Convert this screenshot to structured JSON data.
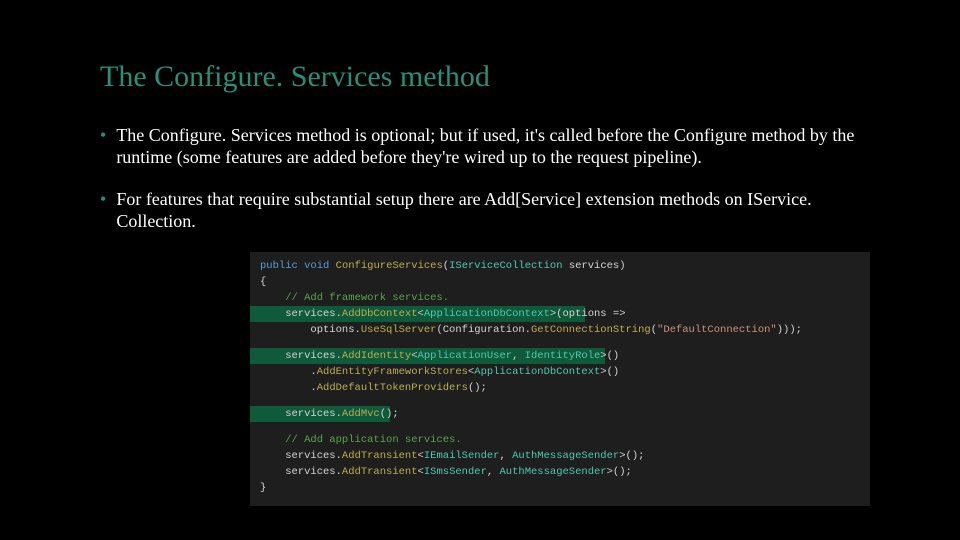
{
  "slide": {
    "title": "The Configure. Services method",
    "bullets": [
      "The Configure. Services method is optional; but if used, it's called before the Configure method by the runtime (some features are added before they're wired up to the request pipeline).",
      "For features that require substantial setup there are Add[Service] extension methods on IService. Collection."
    ]
  },
  "code": {
    "sig_kw1": "public",
    "sig_kw2": "void",
    "sig_name": "ConfigureServices",
    "sig_paramtype": "IServiceCollection",
    "sig_paramname": "services",
    "brace_open": "{",
    "comment1": "    // Add framework services.",
    "l1a": "    services.",
    "l1_add": "AddDbContext",
    "l1_lt": "<",
    "l1_type": "ApplicationDbContext",
    "l1_gt": ">(options =>",
    "l2a": "        options.",
    "l2_use": "UseSqlServer",
    "l2_cfg": "(Configuration.",
    "l2_get": "GetConnectionString",
    "l2_paren": "(",
    "l2_str": "\"DefaultConnection\"",
    "l2_end": ")));",
    "l3a": "    services.",
    "l3_add": "AddIdentity",
    "l3_lt": "<",
    "l3_t1": "ApplicationUser",
    "l3_comma": ", ",
    "l3_t2": "IdentityRole",
    "l3_gt": ">()",
    "l4a": "        .",
    "l4_m": "AddEntityFrameworkStores",
    "l4_lt": "<",
    "l4_t": "ApplicationDbContext",
    "l4_gt": ">()",
    "l5a": "        .",
    "l5_m": "AddDefaultTokenProviders",
    "l5_end": "();",
    "l6a": "    services.",
    "l6_m": "AddMvc",
    "l6_end": "();",
    "comment2": "    // Add application services.",
    "l7a": "    services.",
    "l7_m": "AddTransient",
    "l7_lt": "<",
    "l7_t1": "IEmailSender",
    "l7_comma": ", ",
    "l7_t2": "AuthMessageSender",
    "l7_gt": ">();",
    "l8a": "    services.",
    "l8_m": "AddTransient",
    "l8_lt": "<",
    "l8_t1": "ISmsSender",
    "l8_comma": ", ",
    "l8_t2": "AuthMessageSender",
    "l8_gt": ">();",
    "brace_close": "}"
  }
}
